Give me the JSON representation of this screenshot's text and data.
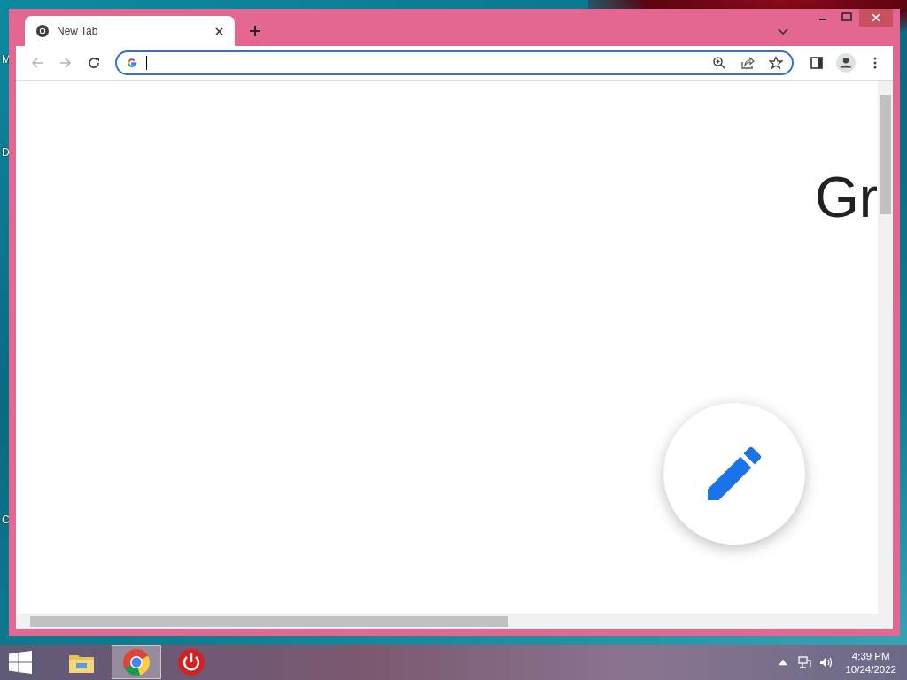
{
  "desktop": {
    "icon_labels": [
      "M",
      "D",
      "C"
    ]
  },
  "window": {
    "tabs": [
      {
        "title": "New Tab",
        "selected": true
      }
    ]
  },
  "page": {
    "heading": "Gr"
  },
  "taskbar": {
    "apps": [
      {
        "kind": "explorer",
        "selected": false
      },
      {
        "kind": "chrome",
        "selected": true
      },
      {
        "kind": "power",
        "selected": false
      }
    ],
    "clock": {
      "time": "4:39 PM",
      "date": "10/24/2022"
    }
  }
}
